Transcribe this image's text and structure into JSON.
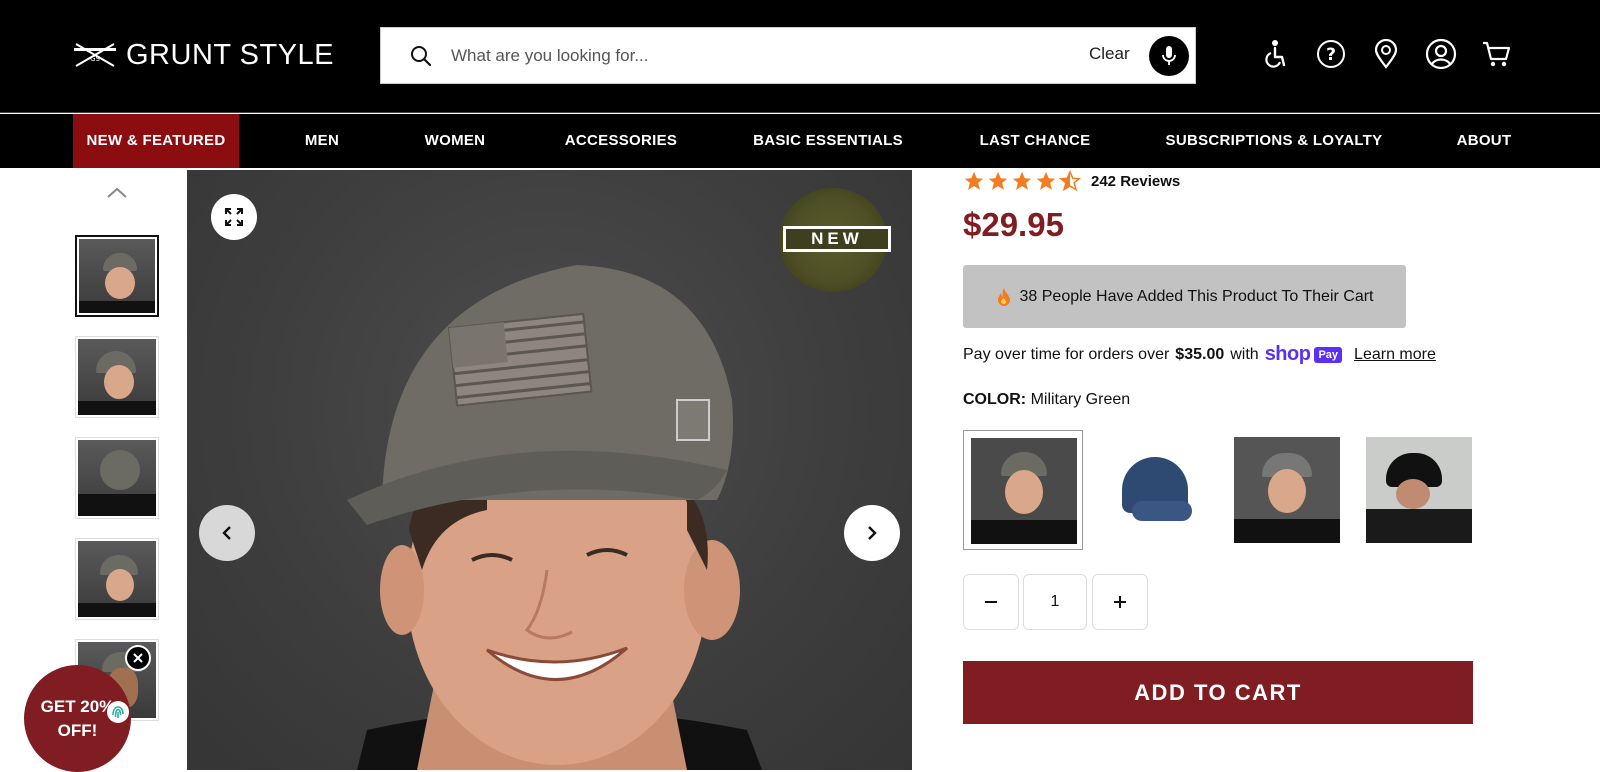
{
  "header": {
    "logo_text": "GRUNT STYLE",
    "search_placeholder": "What are you looking for...",
    "clear_label": "Clear",
    "icons": [
      "accessibility-icon",
      "help-icon",
      "store-locator-icon",
      "account-icon",
      "cart-icon"
    ]
  },
  "nav": {
    "items": [
      {
        "label": "NEW & FEATURED",
        "active": true
      },
      {
        "label": "MEN"
      },
      {
        "label": "WOMEN"
      },
      {
        "label": "ACCESSORIES"
      },
      {
        "label": "BASIC ESSENTIALS"
      },
      {
        "label": "LAST CHANCE"
      },
      {
        "label": "SUBSCRIPTIONS & LOYALTY"
      },
      {
        "label": "ABOUT"
      }
    ]
  },
  "gallery": {
    "badge": "NEW",
    "thumbnail_count": 5
  },
  "product": {
    "rating": 4.5,
    "reviews_label": "242 Reviews",
    "price": "$29.95",
    "cart_notice": "38 People Have Added This Product To Their Cart",
    "pay_over_prefix": "Pay over time for orders over",
    "pay_over_amount": "$35.00",
    "pay_over_with": "with",
    "shop_logo": "shop",
    "pay_chip": "Pay",
    "learn_more": "Learn more",
    "color_key": "COLOR:",
    "color_value": "Military Green",
    "quantity": "1",
    "add_to_cart": "ADD TO CART"
  },
  "promo": {
    "line1": "GET 20%",
    "line2": "OFF!"
  },
  "colors": {
    "brand_red": "#7f1d22",
    "nav_active": "#8b0d10",
    "star": "#f47b20",
    "shop_purple": "#5a31f4"
  }
}
